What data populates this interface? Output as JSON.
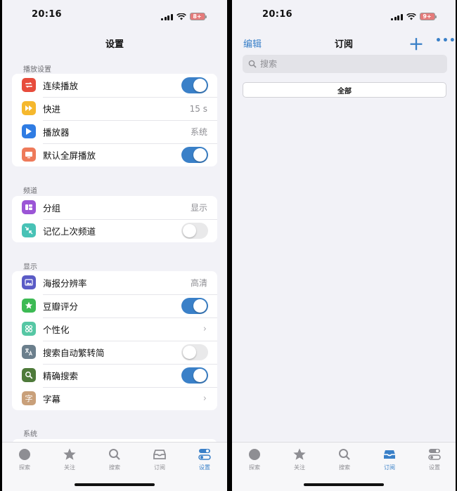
{
  "left": {
    "status": {
      "time": "20:16",
      "battery": "8+"
    },
    "title": "设置",
    "sections": {
      "playback": {
        "header": "播放设置",
        "rows": [
          {
            "label": "连续播放",
            "toggle": true
          },
          {
            "label": "快进",
            "value": "15 s"
          },
          {
            "label": "播放器",
            "value": "系统"
          },
          {
            "label": "默认全屏播放",
            "toggle": true
          }
        ]
      },
      "channel": {
        "header": "频道",
        "rows": [
          {
            "label": "分组",
            "value": "显示"
          },
          {
            "label": "记忆上次频道",
            "toggle": false
          }
        ]
      },
      "display": {
        "header": "显示",
        "rows": [
          {
            "label": "海报分辨率",
            "value": "高清"
          },
          {
            "label": "豆瓣评分",
            "toggle": true
          },
          {
            "label": "个性化"
          },
          {
            "label": "搜索自动繁转简",
            "toggle": false
          },
          {
            "label": "精确搜索",
            "toggle": true
          },
          {
            "label": "字幕"
          }
        ]
      },
      "system": {
        "header": "系统"
      }
    },
    "tabs": [
      {
        "label": "探索"
      },
      {
        "label": "关注"
      },
      {
        "label": "搜索"
      },
      {
        "label": "订阅"
      },
      {
        "label": "设置"
      }
    ],
    "icon_glyphs": {
      "subtitle": "字"
    }
  },
  "right": {
    "status": {
      "time": "20:16",
      "battery": "9+"
    },
    "title": "订阅",
    "edit_label": "编辑",
    "search_placeholder": "搜索",
    "segment_all": "全部",
    "tabs": [
      {
        "label": "探索"
      },
      {
        "label": "关注"
      },
      {
        "label": "搜索"
      },
      {
        "label": "订阅"
      },
      {
        "label": "设置"
      }
    ]
  },
  "colors": {
    "accent": "#3a80c8",
    "icon_repeat": "#e74c3c",
    "icon_forward": "#f5b82e",
    "icon_player": "#2f7ce3",
    "icon_fullscreen": "#ee7a5a",
    "icon_group": "#9b55d6",
    "icon_memory": "#48c2b6",
    "icon_poster": "#5a5bc6",
    "icon_douban": "#3cba54",
    "icon_personal": "#56c7a4",
    "icon_translate": "#6b7f8c",
    "icon_exact": "#4e7a3a",
    "icon_subtitle": "#c9a07a"
  },
  "icons": {
    "repeat": "repeat-icon",
    "forward": "fast-forward-icon",
    "player": "play-icon",
    "fullscreen": "screen-icon",
    "group": "grid-group-icon",
    "memory": "compress-arrows-icon",
    "poster": "image-icon",
    "douban": "star-icon",
    "personal": "four-circles-icon",
    "translate": "translate-icon",
    "exact": "magnifier-icon",
    "subtitle": "subtitle-character-icon"
  }
}
